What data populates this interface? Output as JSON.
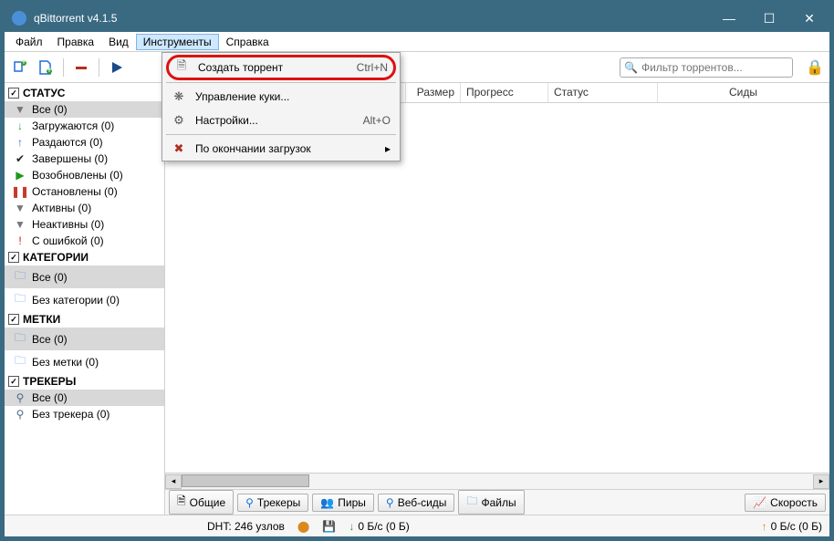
{
  "window": {
    "title": "qBittorrent v4.1.5"
  },
  "menubar": {
    "file": "Файл",
    "edit": "Правка",
    "view": "Вид",
    "tools": "Инструменты",
    "help": "Справка"
  },
  "dropdown": {
    "create": {
      "label": "Создать торрент",
      "accel": "Ctrl+N"
    },
    "cookies": {
      "label": "Управление куки..."
    },
    "settings": {
      "label": "Настройки...",
      "accel": "Alt+O"
    },
    "onfinish": {
      "label": "По окончании загрузок"
    }
  },
  "search": {
    "placeholder": "Фильтр торрентов..."
  },
  "columns": {
    "size": "Размер",
    "progress": "Прогресс",
    "status": "Статус",
    "seeds": "Сиды"
  },
  "sidebar": {
    "status": {
      "head": "СТАТУС",
      "items": [
        {
          "icon": "filter-icon",
          "color": "#777",
          "label": "Все (0)",
          "selected": true
        },
        {
          "icon": "download-icon",
          "color": "#2e9e2e",
          "label": "Загружаются (0)"
        },
        {
          "icon": "upload-icon",
          "color": "#1e6fd9",
          "label": "Раздаются (0)"
        },
        {
          "icon": "check-icon",
          "color": "#222",
          "label": "Завершены (0)"
        },
        {
          "icon": "play-icon",
          "color": "#1a991a",
          "label": "Возобновлены (0)"
        },
        {
          "icon": "pause-icon",
          "color": "#c23b2e",
          "label": "Остановлены (0)"
        },
        {
          "icon": "filter-icon",
          "color": "#777",
          "label": "Активны (0)"
        },
        {
          "icon": "filter-icon",
          "color": "#777",
          "label": "Неактивны (0)"
        },
        {
          "icon": "error-icon",
          "color": "#d11",
          "label": "С ошибкой (0)"
        }
      ]
    },
    "categories": {
      "head": "КАТЕГОРИИ",
      "items": [
        {
          "icon": "folder-icon",
          "color": "#4a90d9",
          "label": "Все (0)",
          "selected": true
        },
        {
          "icon": "folder-icon",
          "color": "#4a90d9",
          "label": "Без категории (0)"
        }
      ]
    },
    "tags": {
      "head": "МЕТКИ",
      "items": [
        {
          "icon": "folder-icon",
          "color": "#4a90d9",
          "label": "Все (0)",
          "selected": true
        },
        {
          "icon": "folder-icon",
          "color": "#4a90d9",
          "label": "Без метки (0)"
        }
      ]
    },
    "trackers": {
      "head": "ТРЕКЕРЫ",
      "items": [
        {
          "icon": "tracker-icon",
          "color": "#4a6a8a",
          "label": "Все (0)",
          "selected": true
        },
        {
          "icon": "tracker-icon",
          "color": "#4a6a8a",
          "label": "Без трекера (0)"
        }
      ]
    }
  },
  "tabs": {
    "general": "Общие",
    "trackers": "Трекеры",
    "peers": "Пиры",
    "webseeds": "Веб-сиды",
    "files": "Файлы",
    "speed": "Скорость"
  },
  "status": {
    "dht": "DHT: 246 узлов",
    "down": "0 Б/с (0 Б)",
    "up": "0 Б/с (0 Б)"
  },
  "glyphs": {
    "filter-icon": "▼",
    "download-icon": "↓",
    "upload-icon": "↑",
    "check-icon": "✔",
    "play-icon": "▶",
    "pause-icon": "❚❚",
    "error-icon": "!",
    "folder-icon": "🗀",
    "tracker-icon": "⚲"
  }
}
